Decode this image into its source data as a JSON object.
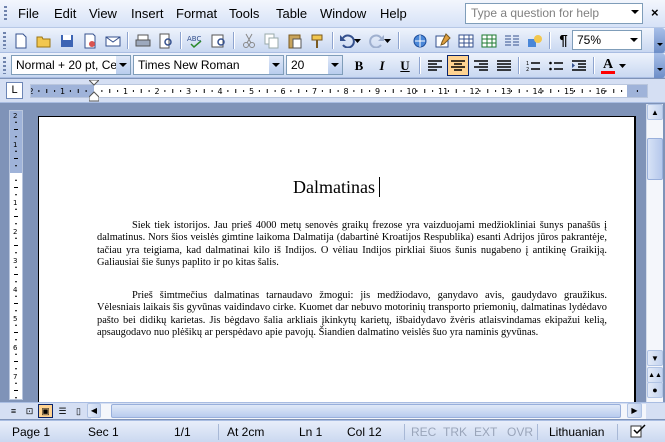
{
  "menu": [
    "File",
    "Edit",
    "View",
    "Insert",
    "Format",
    "Tools",
    "Table",
    "Window",
    "Help"
  ],
  "ask_box_placeholder": "Type a question for help",
  "standard_toolbar": {
    "zoom": "75%"
  },
  "formatting_toolbar": {
    "style": "Normal + 20 pt, Ce",
    "font": "Times New Roman",
    "size": "20",
    "bold": "B",
    "italic": "I",
    "underline": "U",
    "font_color_glyph": "A"
  },
  "ruler": {
    "unit_tab_glyph": "L",
    "numbers": [
      "2",
      "1",
      "1",
      "2",
      "3",
      "4",
      "5",
      "6",
      "7",
      "8",
      "9",
      "10",
      "11",
      "12",
      "13",
      "14",
      "15",
      "16"
    ]
  },
  "vruler_numbers": [
    "2",
    "1",
    "1",
    "2",
    "3",
    "4",
    "5",
    "6",
    "7",
    "8"
  ],
  "document": {
    "title": "Dalmatinas",
    "paragraphs": [
      "Siek tiek istorijos. Jau prieš 4000 metų senovės graikų frezose yra vaizduojami medžiokliniai šunys panašūs į dalmatinus. Nors šios veislės gimtine laikoma Dalmatija (dabartinė Kroatijos Respublika) esanti Adrijos jūros pakrantėje, tačiau yra teigiama, kad dalmatinai kilo iš Indijos. O vėliau Indijos pirkliai šiuos šunis nugabeno į antikinę Graikiją. Galiausiai šie šunys paplito ir po kitas šalis.",
      "Prieš šimtmečius dalmatinas tarnaudavo žmogui: jis medžiodavo, ganydavo avis, gaudydavo graužikus. Vėlesniais laikais šis gyvūnas vaidindavo cirke. Kuomet dar nebuvo motorinių transporto priemonių, dalmatinas lydėdavo pašto bei didikų karietas. Jis bėgdavo šalia arkliais įkinkytų karietų, išbaidydavo žvėris atlaisvindamas ekipažui kelią, apsaugodavo nuo plėšikų ar perspėdavo apie pavojų. Šiandien dalmatino veislės šuo yra naminis gyvūnas."
    ]
  },
  "status": {
    "page": "Page 1",
    "sec": "Sec 1",
    "of": "1/1",
    "at": "At 2cm",
    "ln": "Ln 1",
    "col": "Col 12",
    "rec": "REC",
    "trk": "TRK",
    "ext": "EXT",
    "ovr": "OVR",
    "language": "Lithuanian"
  },
  "colors": {
    "toolbar": "#d6e2f7",
    "workspace": "#7f93b8",
    "active_button": "#ffd391",
    "font_color_bar": "#ff0000"
  }
}
